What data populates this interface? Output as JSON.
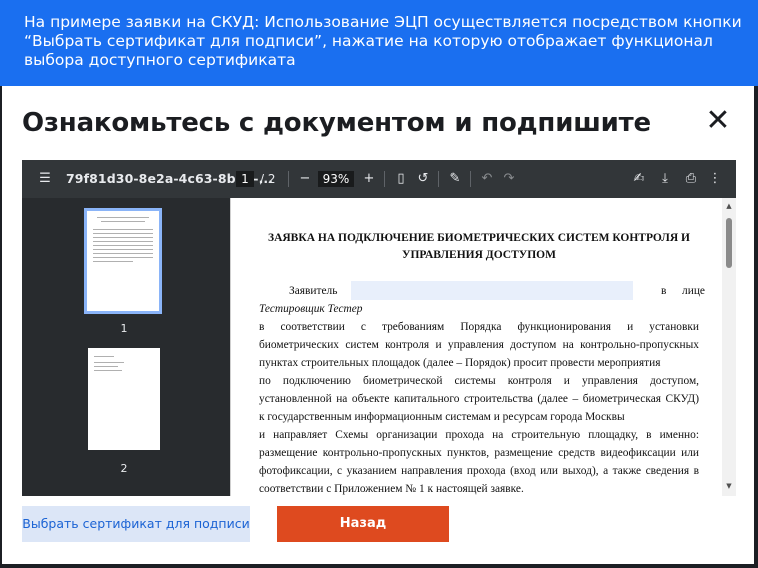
{
  "banner": {
    "text": "На примере заявки на СКУД: Использование ЭЦП осуществляется посредством кнопки “Выбрать сертификат для подписи”, нажатие на которую отображает функционал выбора доступного сертификата"
  },
  "modal": {
    "title": "Ознакомьтесь с документом и подпишите",
    "close_icon": "✕"
  },
  "viewer": {
    "filename": "79f81d30-8e2a-4c63-8b13-...",
    "current_page": "1",
    "total_pages": "/ 2",
    "zoom": "93%",
    "icons": {
      "menu": "menu-icon",
      "minus": "zoom-out-icon",
      "plus": "zoom-in-icon",
      "fit": "fit-page-icon",
      "rotate": "rotate-icon",
      "annotate": "annotate-icon",
      "undo": "undo-icon",
      "redo": "redo-icon",
      "sign": "sign-icon",
      "download": "download-icon",
      "print": "print-icon",
      "more": "more-icon"
    },
    "thumbnails": [
      "1",
      "2"
    ]
  },
  "document": {
    "title": "ЗАЯВКА НА ПОДКЛЮЧЕНИЕ БИОМЕТРИЧЕСКИХ СИСТЕМ КОНТРОЛЯ И УПРАВЛЕНИЯ ДОСТУПОМ",
    "applicant_label": "Заявитель",
    "applicant_suffix": "в лице",
    "lines": [
      "Тестировщик Тестер",
      "в соответствии с требованиям Порядка функционирования и установки",
      "биометрических систем контроля и управления доступом на контрольно-пропускных",
      "пунктах строительных площадок (далее – Порядок) просит провести мероприятия",
      "по подключению биометрической системы контроля и управления доступом,",
      "установленной на объекте капитального строительства (далее – биометрическая СКУД)",
      "к государственным информационным системам и ресурсам города Москвы",
      "и направляет Схемы организации прохода на строительную площадку, в именно:",
      "размещение контрольно-пропускных пунктов, размещение средств видеофиксации или",
      "фотофиксации, с указанием направления прохода (вход или выход), а также сведения в",
      "соответствии с Приложением № 1 к настоящей заявке."
    ]
  },
  "buttons": {
    "select_cert": "Выбрать сертификат для подписи",
    "back": "Назад"
  },
  "colors": {
    "banner": "#1a6ff0",
    "back_button": "#de4a1f",
    "cert_button_bg": "#dce6f7",
    "cert_button_text": "#1b63d4"
  }
}
